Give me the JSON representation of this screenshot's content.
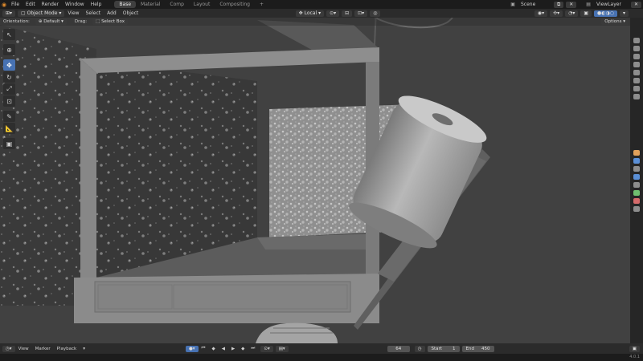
{
  "topbar": {
    "menus": [
      "File",
      "Edit",
      "Render",
      "Window",
      "Help"
    ],
    "workspaces": [
      "Base",
      "Material",
      "Comp",
      "Layout",
      "Compositing"
    ],
    "add_tab": "+",
    "scene": "Scene",
    "viewlayer": "ViewLayer"
  },
  "header": {
    "mode": "Object Mode",
    "menus": [
      "View",
      "Select",
      "Add",
      "Object"
    ],
    "transform": "Local"
  },
  "subheader": {
    "orientation_label": "Orientation:",
    "orientation_value": "Default",
    "drag_label": "Drag:",
    "drag_value": "Select Box",
    "options": "Options"
  },
  "timeline": {
    "menus": [
      "View",
      "Marker",
      "Playback"
    ],
    "current_frame": "64",
    "start_label": "Start",
    "start_value": "1",
    "end_label": "End",
    "end_value": "450"
  },
  "status": {
    "version": "4.0.1"
  },
  "icons": {
    "toolbar": [
      "cursor-select-icon",
      "cursor-3d-icon",
      "move-icon",
      "rotate-icon",
      "scale-icon",
      "transform-icon",
      "annotate-icon",
      "measure-icon",
      "add-cube-icon"
    ]
  },
  "colors": {
    "accent": "#4772b3",
    "viewport_bg": "#3f3f3f",
    "panel_bg": "#2b2b2b"
  }
}
